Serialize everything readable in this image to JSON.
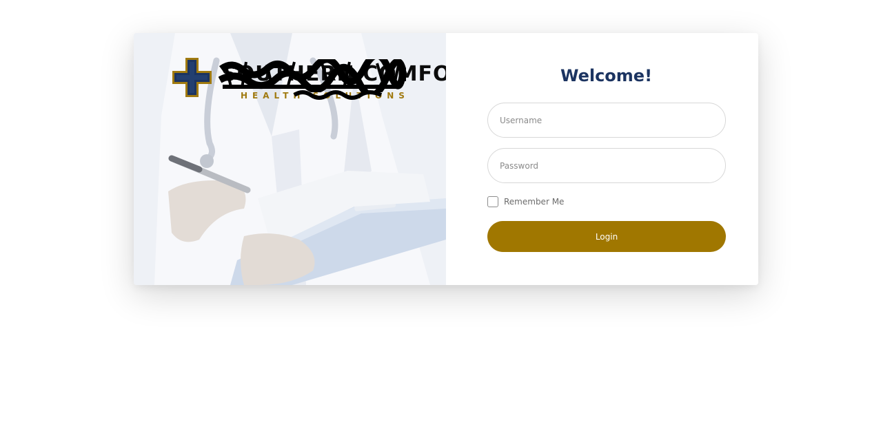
{
  "brand": {
    "name": "SOUTHERN COMFORT",
    "tagline": "HEALTH SOLUTIONS",
    "logo_icon": "medical-cross-icon",
    "colors": {
      "navy": "#1c3461",
      "gold": "#a07700"
    }
  },
  "login": {
    "title": "Welcome!",
    "username": {
      "placeholder": "Username",
      "value": ""
    },
    "password": {
      "placeholder": "Password",
      "value": ""
    },
    "remember_label": "Remember Me",
    "remember_checked": false,
    "submit_label": "Login"
  }
}
